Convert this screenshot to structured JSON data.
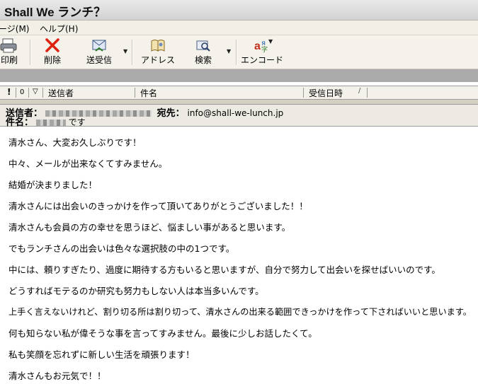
{
  "window": {
    "title": "Shall We ランチ？"
  },
  "menu": {
    "items": [
      "ージ(M)",
      "ヘルプ(H)"
    ]
  },
  "toolbar": {
    "print": "印刷",
    "delete": "削除",
    "sendrecv": "送受信",
    "address": "アドレス",
    "search": "検索",
    "encode": "エンコード"
  },
  "columns": {
    "priority": "!",
    "attach": "0",
    "flag": "▽",
    "from": "送信者",
    "subject": "件名",
    "received": "受信日時",
    "sort": "/"
  },
  "header": {
    "from_label": "送信者：",
    "to_label": "宛先：",
    "to_value": "info@shall-we-lunch.jp",
    "subject_label": "件名：",
    "subject_value": "です"
  },
  "body": {
    "lines": [
      "清水さん、大変お久しぶりです！",
      "中々、メールが出来なくてすみません。",
      "結婚が決まりました！",
      "清水さんには出会いのきっかけを作って頂いてありがとうございました！！",
      "清水さんも会員の方の幸せを思うほど、悩ましい事があると思います。",
      "でもランチさんの出会いは色々な選択肢の中の1つです。",
      "中には、頼りすぎたり、過度に期待する方もいると思いますが、自分で努力して出会いを探せばいいのです。",
      "どうすればモテるのか研究も努力もしない人は本当多いんです。",
      "上手く言えないけれど、割り切る所は割り切って、清水さんの出来る範囲できっかけを作って下さればいいと思います。",
      "何も知らない私が偉そうな事を言ってすみません。最後に少しお話したくて。",
      "私も笑顔を忘れずに新しい生活を頑張ります！",
      "清水さんもお元気で！！"
    ]
  }
}
